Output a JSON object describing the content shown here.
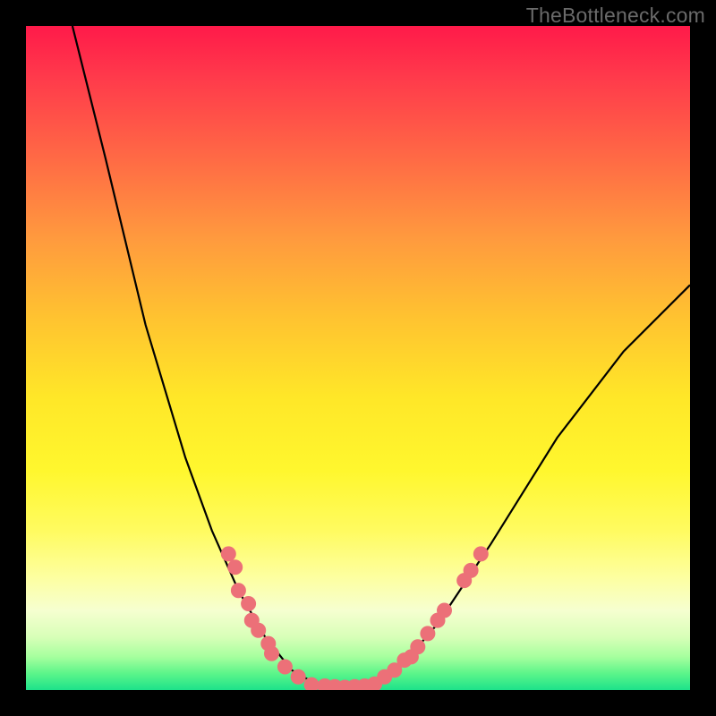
{
  "watermark": "TheBottleneck.com",
  "chart_data": {
    "type": "line",
    "title": "",
    "xlabel": "",
    "ylabel": "",
    "xlim": [
      0,
      100
    ],
    "ylim": [
      0,
      100
    ],
    "curve": {
      "name": "bottleneck-curve",
      "points": [
        {
          "x": 7,
          "y": 100
        },
        {
          "x": 12,
          "y": 80
        },
        {
          "x": 18,
          "y": 55
        },
        {
          "x": 24,
          "y": 35
        },
        {
          "x": 28,
          "y": 24
        },
        {
          "x": 32,
          "y": 15
        },
        {
          "x": 36,
          "y": 8
        },
        {
          "x": 40,
          "y": 3
        },
        {
          "x": 44,
          "y": 0.7
        },
        {
          "x": 48,
          "y": 0.3
        },
        {
          "x": 52,
          "y": 0.7
        },
        {
          "x": 56,
          "y": 3
        },
        {
          "x": 62,
          "y": 10
        },
        {
          "x": 70,
          "y": 22
        },
        {
          "x": 80,
          "y": 38
        },
        {
          "x": 90,
          "y": 51
        },
        {
          "x": 100,
          "y": 61
        }
      ]
    },
    "series": [
      {
        "name": "left-cluster",
        "points": [
          {
            "x": 30.5,
            "y": 20.5
          },
          {
            "x": 31.5,
            "y": 18.5
          },
          {
            "x": 32.0,
            "y": 15.0
          },
          {
            "x": 33.5,
            "y": 13.0
          },
          {
            "x": 34.0,
            "y": 10.5
          },
          {
            "x": 35.0,
            "y": 9.0
          },
          {
            "x": 36.5,
            "y": 7.0
          },
          {
            "x": 37.0,
            "y": 5.5
          },
          {
            "x": 39.0,
            "y": 3.5
          },
          {
            "x": 41.0,
            "y": 2.0
          }
        ]
      },
      {
        "name": "valley-cluster",
        "points": [
          {
            "x": 43.0,
            "y": 0.8
          },
          {
            "x": 45.0,
            "y": 0.6
          },
          {
            "x": 46.5,
            "y": 0.5
          },
          {
            "x": 48.0,
            "y": 0.4
          },
          {
            "x": 49.5,
            "y": 0.5
          },
          {
            "x": 51.0,
            "y": 0.6
          },
          {
            "x": 52.5,
            "y": 0.9
          }
        ]
      },
      {
        "name": "right-cluster",
        "points": [
          {
            "x": 54.0,
            "y": 2.0
          },
          {
            "x": 55.5,
            "y": 3.0
          },
          {
            "x": 57.0,
            "y": 4.5
          },
          {
            "x": 58.0,
            "y": 5.0
          },
          {
            "x": 59.0,
            "y": 6.5
          },
          {
            "x": 60.5,
            "y": 8.5
          },
          {
            "x": 62.0,
            "y": 10.5
          },
          {
            "x": 63.0,
            "y": 12.0
          },
          {
            "x": 66.0,
            "y": 16.5
          },
          {
            "x": 67.0,
            "y": 18.0
          },
          {
            "x": 68.5,
            "y": 20.5
          }
        ]
      }
    ]
  }
}
